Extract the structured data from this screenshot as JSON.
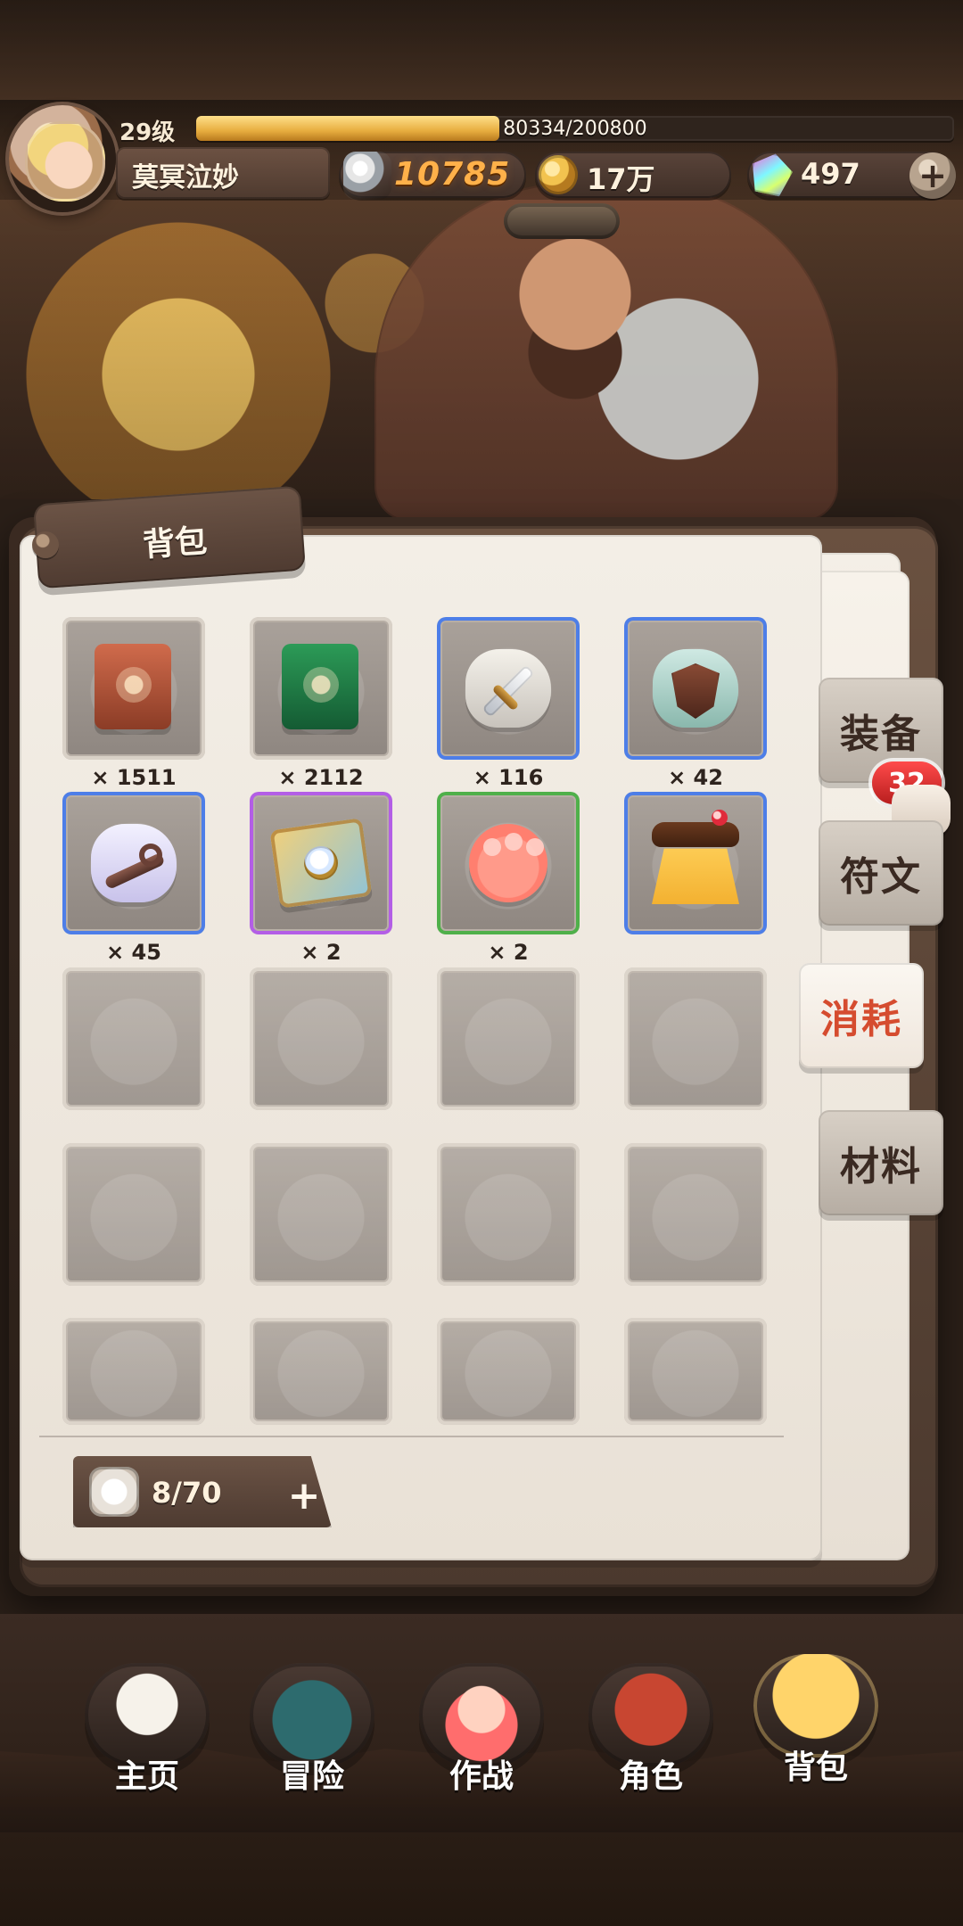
{
  "player": {
    "level": "29级",
    "exp_text": "80334/200800",
    "exp_progress": 0.4,
    "name": "莫冥泣妙"
  },
  "resources": {
    "power": "10785",
    "gold": "17万",
    "gems": "497",
    "plus": "+"
  },
  "bag": {
    "title": "背包",
    "tabs": [
      {
        "label": "装备",
        "active": false
      },
      {
        "label": "符文",
        "active": false
      },
      {
        "label": "消耗",
        "active": true
      },
      {
        "label": "材料",
        "active": false
      }
    ],
    "notification_count": "32",
    "items": [
      {
        "icon": "red-book-icon",
        "rarity": "normal",
        "count": "× 1511"
      },
      {
        "icon": "green-book-icon",
        "rarity": "normal",
        "count": "× 2112"
      },
      {
        "icon": "sword-stone-icon",
        "rarity": "blue",
        "count": "× 116"
      },
      {
        "icon": "shield-stone-icon",
        "rarity": "blue",
        "count": "× 42"
      },
      {
        "icon": "key-stone-icon",
        "rarity": "blue",
        "count": "× 45"
      },
      {
        "icon": "treasure-map-icon",
        "rarity": "purple",
        "count": "× 2"
      },
      {
        "icon": "paw-icon",
        "rarity": "green",
        "count": "× 2"
      },
      {
        "icon": "pudding-icon",
        "rarity": "blue",
        "count": ""
      }
    ],
    "capacity": "8/70",
    "capacity_plus": "+"
  },
  "bottom_nav": [
    {
      "label": "主页",
      "icon": "home-icon",
      "active": false
    },
    {
      "label": "冒险",
      "icon": "adventure-icon",
      "active": false
    },
    {
      "label": "作战",
      "icon": "battle-icon",
      "active": false
    },
    {
      "label": "角色",
      "icon": "role-icon",
      "active": false
    },
    {
      "label": "背包",
      "icon": "bag-icon",
      "active": true
    }
  ]
}
